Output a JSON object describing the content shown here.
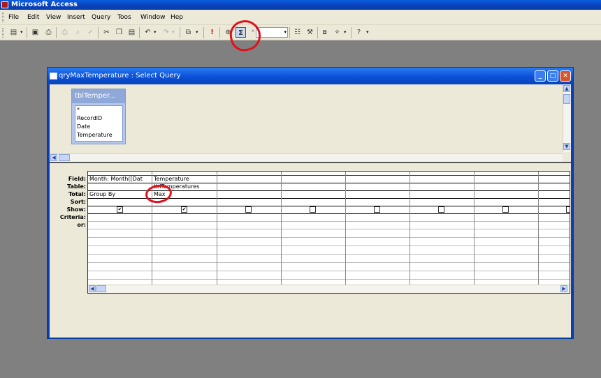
{
  "app": {
    "title": "Microsoft Access"
  },
  "menu": [
    "File",
    "Edit",
    "View",
    "Insert",
    "Query",
    "Toos",
    "Window",
    "Hep"
  ],
  "toolbar": {
    "combo_value": ""
  },
  "query_window": {
    "title": "qryMaxTemperature : Select Query"
  },
  "table_list": {
    "title": "tblTemper...",
    "fields": [
      "*",
      "RecordID",
      "Date",
      "Temperature"
    ]
  },
  "grid": {
    "row_labels": [
      "Field:",
      "Table:",
      "Total:",
      "Sort:",
      "Show:",
      "Criteria:",
      "or:"
    ],
    "columns": [
      {
        "field": "Month: Month([Dat",
        "table": "",
        "total": "Group By",
        "sort": "",
        "show": true
      },
      {
        "field": "Temperature",
        "table": "tblTemperatures",
        "total": "Max",
        "sort": "",
        "show": true
      },
      {
        "field": "",
        "table": "",
        "total": "",
        "sort": "",
        "show": false
      },
      {
        "field": "",
        "table": "",
        "total": "",
        "sort": "",
        "show": false
      },
      {
        "field": "",
        "table": "",
        "total": "",
        "sort": "",
        "show": false
      },
      {
        "field": "",
        "table": "",
        "total": "",
        "sort": "",
        "show": false
      },
      {
        "field": "",
        "table": "",
        "total": "",
        "sort": "",
        "show": false
      },
      {
        "field": "",
        "table": "",
        "total": "",
        "sort": "",
        "show": false
      }
    ]
  },
  "annotations": {
    "highlight_color": "#e2101a"
  },
  "colors": {
    "titlebar": "#0a50d8",
    "workspace": "#808080",
    "chrome": "#ece9d8"
  }
}
